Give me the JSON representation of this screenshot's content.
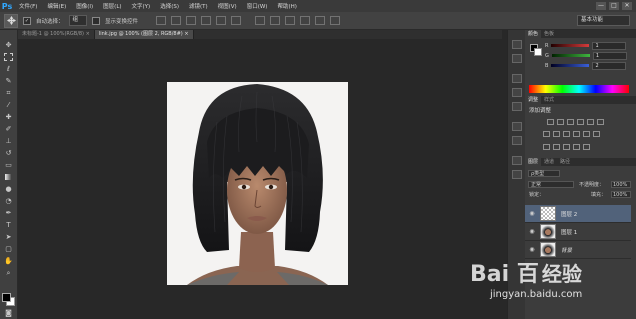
{
  "app": {
    "logo": "Ps",
    "accent": "#31a8ff"
  },
  "menu": [
    "文件(F)",
    "编辑(E)",
    "图像(I)",
    "图层(L)",
    "文字(Y)",
    "选择(S)",
    "滤镜(T)",
    "视图(V)",
    "窗口(W)",
    "帮助(H)"
  ],
  "window_controls": {
    "minimize": "—",
    "maximize": "□",
    "close": "✕"
  },
  "options": {
    "auto_select_label": "自动选择：",
    "auto_select_target": "组",
    "show_transform_label": "显示变换控件",
    "workspace": "基本功能"
  },
  "tabs": [
    {
      "label": "未标题-1 @ 100%(RGB/8)",
      "close": "×"
    },
    {
      "label": "link.jpg @ 100% (图层 2, RGB/8#)",
      "close": "×"
    }
  ],
  "color_panel": {
    "tabs": [
      "颜色",
      "色板"
    ],
    "channels": [
      {
        "label": "R",
        "value": "1",
        "color": "#d43b3b"
      },
      {
        "label": "G",
        "value": "1",
        "color": "#3fb53f"
      },
      {
        "label": "B",
        "value": "2",
        "color": "#3a5fd8"
      }
    ]
  },
  "adjust_panel": {
    "tabs": [
      "调整",
      "样式"
    ],
    "title": "添加调整"
  },
  "layers_panel": {
    "tabs": [
      "图层",
      "通道",
      "路径"
    ],
    "filter": "ρ类型",
    "blend_mode": "正常",
    "opacity_label": "不透明度：",
    "opacity": "100%",
    "lock_label": "锁定：",
    "fill_label": "填充：",
    "fill": "100%",
    "layers": [
      {
        "name": "图层 2",
        "selected": true
      },
      {
        "name": "图层 1",
        "selected": false
      },
      {
        "name": "背景",
        "selected": false
      }
    ]
  },
  "watermark": {
    "brand": "Bai 百",
    "suffix": "经验",
    "url": "jingyan.baidu.com"
  }
}
